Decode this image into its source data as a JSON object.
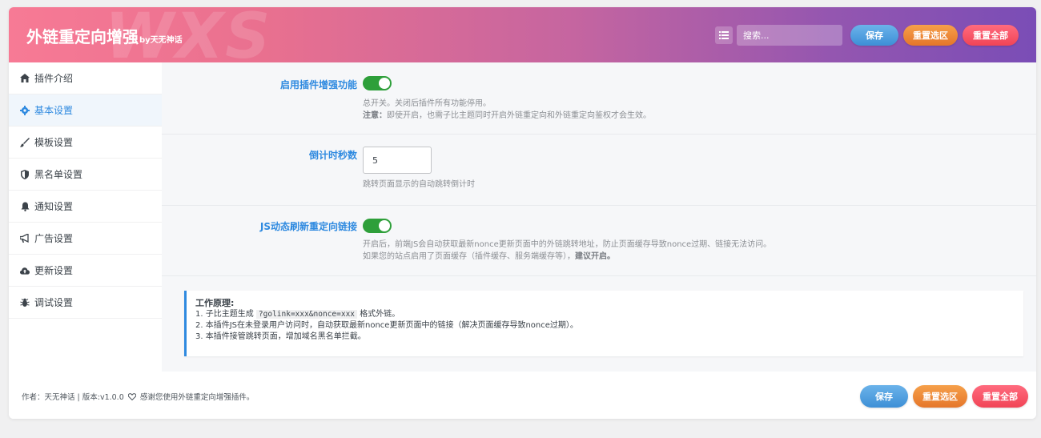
{
  "header": {
    "title": "外链重定向增强",
    "byline": "by天无神话",
    "watermark": "WXS",
    "search_placeholder": "搜索...",
    "save_label": "保存",
    "reset_section_label": "重置选区",
    "reset_all_label": "重置全部"
  },
  "sidebar": {
    "items": [
      {
        "label": "插件介绍",
        "icon": "home-icon"
      },
      {
        "label": "基本设置",
        "icon": "gear-icon",
        "active": true
      },
      {
        "label": "模板设置",
        "icon": "brush-icon"
      },
      {
        "label": "黑名单设置",
        "icon": "shield-icon"
      },
      {
        "label": "通知设置",
        "icon": "bell-icon"
      },
      {
        "label": "广告设置",
        "icon": "bullhorn-icon"
      },
      {
        "label": "更新设置",
        "icon": "cloud-upload-icon"
      },
      {
        "label": "调试设置",
        "icon": "bug-icon"
      }
    ]
  },
  "settings": {
    "enable": {
      "label": "启用插件增强功能",
      "value": true,
      "desc1": "总开关。关闭后插件所有功能停用。",
      "desc2_bold": "注意：",
      "desc2_rest": "即使开启，也需子比主题同时开启外链重定向和外链重定向鉴权才会生效。"
    },
    "countdown": {
      "label": "倒计时秒数",
      "value": "5",
      "desc": "跳转页面显示的自动跳转倒计时"
    },
    "js_refresh": {
      "label": "JS动态刷新重定向链接",
      "value": true,
      "desc1": "开启后，前端JS会自动获取最新nonce更新页面中的外链跳转地址，防止页面缓存导致nonce过期、链接无法访问。",
      "desc2_rest": "如果您的站点启用了页面缓存（插件缓存、服务端缓存等），",
      "desc2_bold": "建议开启。"
    }
  },
  "note": {
    "title": "工作原理:",
    "line1_pre": "1. 子比主题生成 ",
    "line1_code": "?golink=xxx&nonce=xxx",
    "line1_post": " 格式外链。",
    "line2": "2. 本插件JS在未登录用户访问时，自动获取最新nonce更新页面中的链接（解决页面缓存导致nonce过期）。",
    "line3": "3. 本插件接管跳转页面，增加域名黑名单拦截。"
  },
  "footer": {
    "info_pre": "作者：天无神话 | 版本:v1.0.0",
    "info_post": "感谢您使用外链重定向增强插件。",
    "save_label": "保存",
    "reset_section_label": "重置选区",
    "reset_all_label": "重置全部"
  },
  "colors": {
    "accent_blue": "#2f8ae0",
    "toggle_green": "#2e9f3a",
    "header_start": "#f77a95",
    "header_end": "#7a4db6"
  }
}
